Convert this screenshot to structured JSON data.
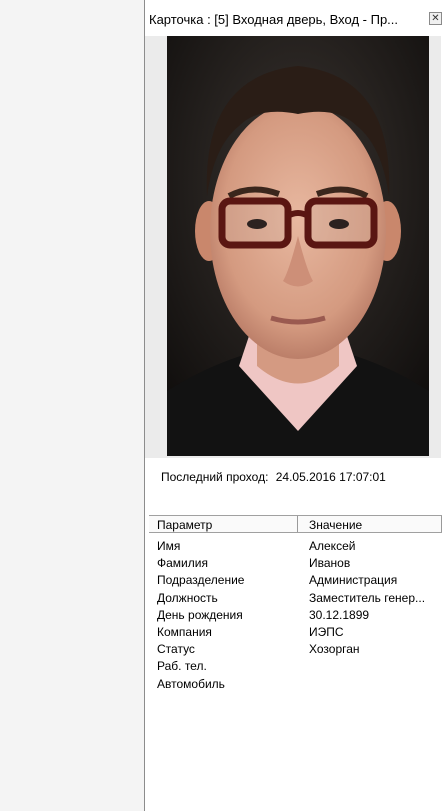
{
  "window": {
    "title": "Карточка : [5] Входная дверь, Вход - Пр...",
    "close_glyph": "✕"
  },
  "photo": {
    "icon": "person-photo"
  },
  "last_pass": {
    "label": "Последний проход:",
    "value": "24.05.2016 17:07:01"
  },
  "grid": {
    "headers": [
      "Параметр",
      "Значение"
    ],
    "rows": [
      {
        "param": "Имя",
        "value": "Алексей"
      },
      {
        "param": "Фамилия",
        "value": "Иванов"
      },
      {
        "param": "Подразделение",
        "value": "Администрация"
      },
      {
        "param": "Должность",
        "value": "Заместитель генер..."
      },
      {
        "param": "День рождения",
        "value": "30.12.1899"
      },
      {
        "param": "Компания",
        "value": "ИЭПС"
      },
      {
        "param": "Статус",
        "value": "Хозорган"
      },
      {
        "param": "Раб. тел.",
        "value": ""
      },
      {
        "param": "Автомобиль",
        "value": ""
      }
    ]
  }
}
